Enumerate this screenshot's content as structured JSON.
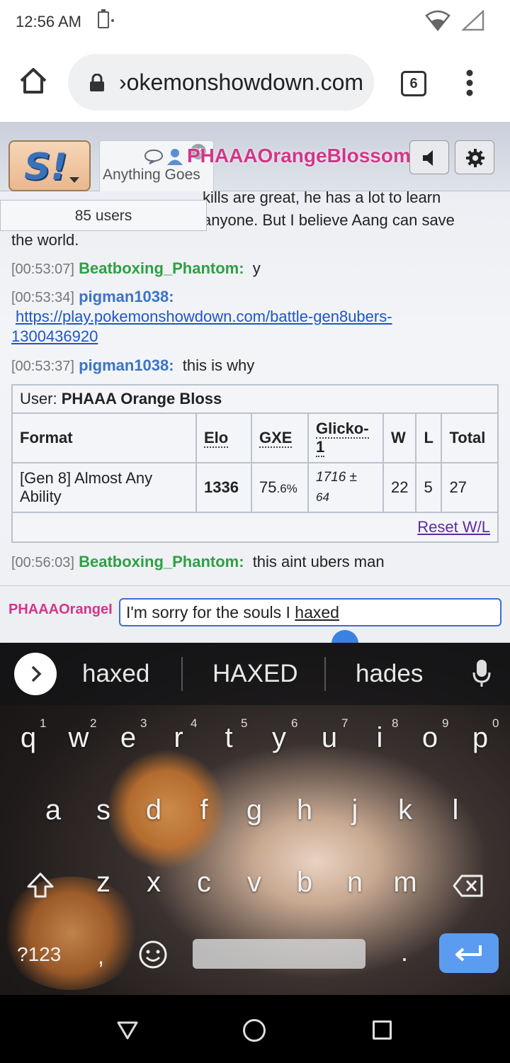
{
  "status": {
    "time": "12:56 AM"
  },
  "browser": {
    "url": "›okemonshowdown.com",
    "tab_count": "6"
  },
  "room": {
    "tab_label": "Anything Goes",
    "user_title": "PHAAAOrangeBlossom",
    "users_count": "85 users"
  },
  "chat": {
    "fragment_top": "kills are great, he has a lot to learn",
    "fragment_line2": "anyone. But I believe Aang can save",
    "fragment_line3": "the world.",
    "messages": [
      {
        "time": "[00:53:07]",
        "nick": "Beatboxing_Phantom:",
        "text": "y"
      },
      {
        "time": "[00:53:34]",
        "nick": "pigman1038:",
        "link_line1": "https://play.pokemonshowdown.com/battle-gen8ubers-",
        "link_line2": "1300436920"
      },
      {
        "time": "[00:53:37]",
        "nick": "pigman1038:",
        "text": "this is why"
      },
      {
        "time": "[00:56:03]",
        "nick": "Beatboxing_Phantom:",
        "text": "this aint ubers man"
      }
    ]
  },
  "rank_table": {
    "user_label": "User:",
    "user_name": "PHAAA Orange Bloss",
    "headers": [
      "Format",
      "Elo",
      "GXE",
      "Glicko-1",
      "W",
      "L",
      "Total"
    ],
    "row": {
      "format": "[Gen 8] Almost Any Ability",
      "elo": "1336",
      "gxe_main": "75",
      "gxe_decimal": ".6%",
      "glicko_value": "1716 ±",
      "glicko_dev": "64",
      "w": "22",
      "l": "5",
      "total": "27"
    },
    "reset_label": "Reset W/L"
  },
  "composer": {
    "nick": "PHAAAOrangeI",
    "input_value_prefix": "I'm sorry for the souls I ",
    "input_value_word": "haxed"
  },
  "keyboard": {
    "suggestions": [
      "haxed",
      "HAXED",
      "hades"
    ],
    "row1": [
      "q",
      "w",
      "e",
      "r",
      "t",
      "y",
      "u",
      "i",
      "o",
      "p"
    ],
    "row1_nums": [
      "1",
      "2",
      "3",
      "4",
      "5",
      "6",
      "7",
      "8",
      "9",
      "0"
    ],
    "row2": [
      "a",
      "s",
      "d",
      "f",
      "g",
      "h",
      "j",
      "k",
      "l"
    ],
    "row3": [
      "z",
      "x",
      "c",
      "v",
      "b",
      "n",
      "m"
    ],
    "symbols_label": "?123",
    "comma": ",",
    "period": ".",
    "enter_color": "#5b9cf0"
  },
  "colors": {
    "accent_pink": "#d4358a",
    "nick_green": "#2ea043",
    "nick_blue": "#3b73c7"
  }
}
